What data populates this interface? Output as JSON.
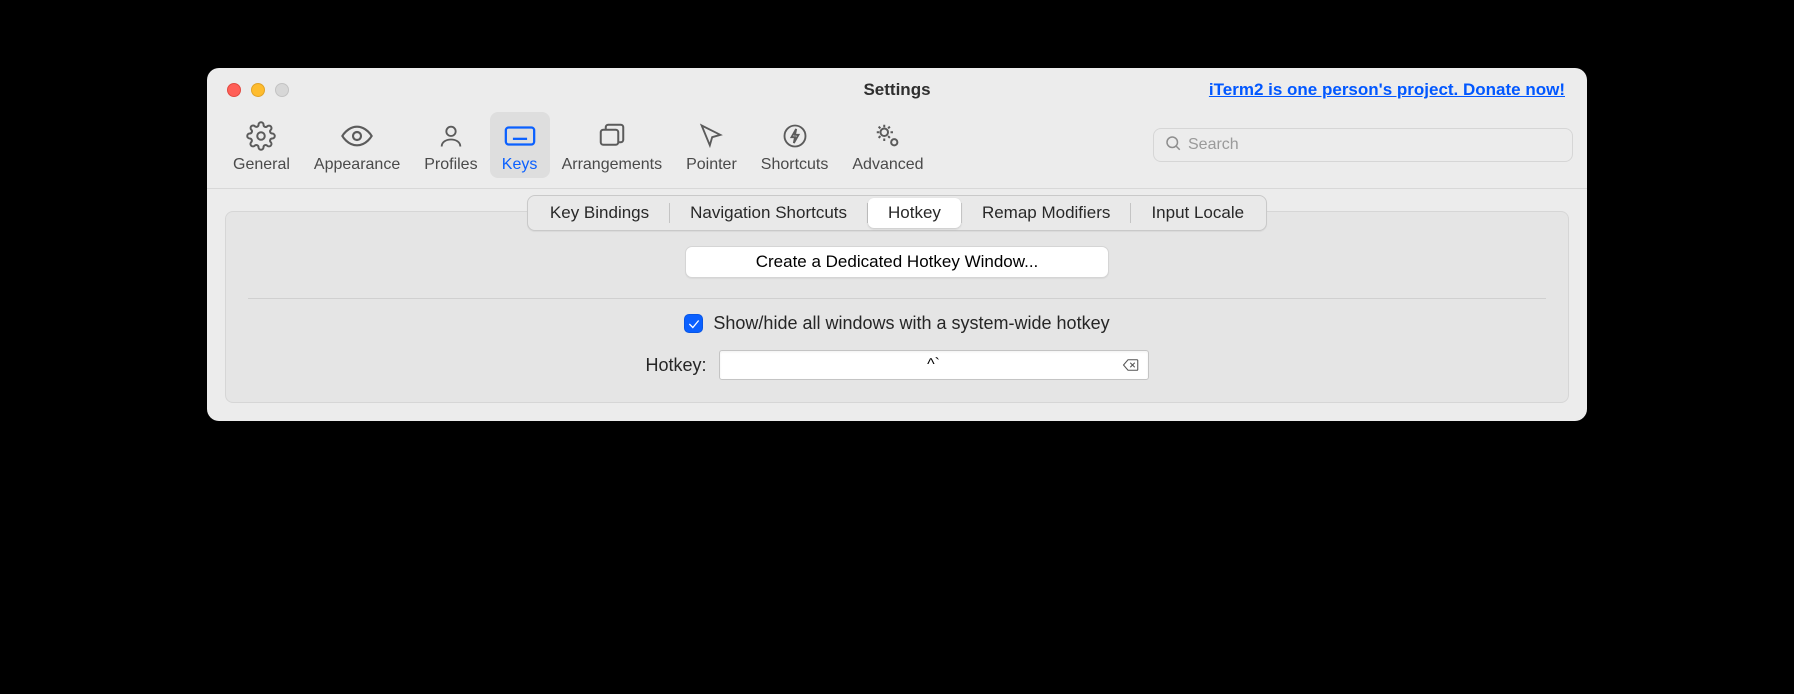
{
  "window": {
    "title": "Settings",
    "donate_link": "iTerm2 is one person's project. Donate now!"
  },
  "toolbar": {
    "items": [
      {
        "id": "general",
        "label": "General"
      },
      {
        "id": "appearance",
        "label": "Appearance"
      },
      {
        "id": "profiles",
        "label": "Profiles"
      },
      {
        "id": "keys",
        "label": "Keys"
      },
      {
        "id": "arrangements",
        "label": "Arrangements"
      },
      {
        "id": "pointer",
        "label": "Pointer"
      },
      {
        "id": "shortcuts",
        "label": "Shortcuts"
      },
      {
        "id": "advanced",
        "label": "Advanced"
      }
    ],
    "active": "keys",
    "search_placeholder": "Search"
  },
  "subtabs": {
    "items": [
      {
        "id": "key-bindings",
        "label": "Key Bindings"
      },
      {
        "id": "navigation-shortcuts",
        "label": "Navigation Shortcuts"
      },
      {
        "id": "hotkey",
        "label": "Hotkey"
      },
      {
        "id": "remap-modifiers",
        "label": "Remap Modifiers"
      },
      {
        "id": "input-locale",
        "label": "Input Locale"
      }
    ],
    "active": "hotkey"
  },
  "hotkey_pane": {
    "create_button": "Create a Dedicated Hotkey Window...",
    "checkbox_checked": true,
    "checkbox_label": "Show/hide all windows with a system-wide hotkey",
    "field_label": "Hotkey:",
    "field_value": "^`"
  }
}
